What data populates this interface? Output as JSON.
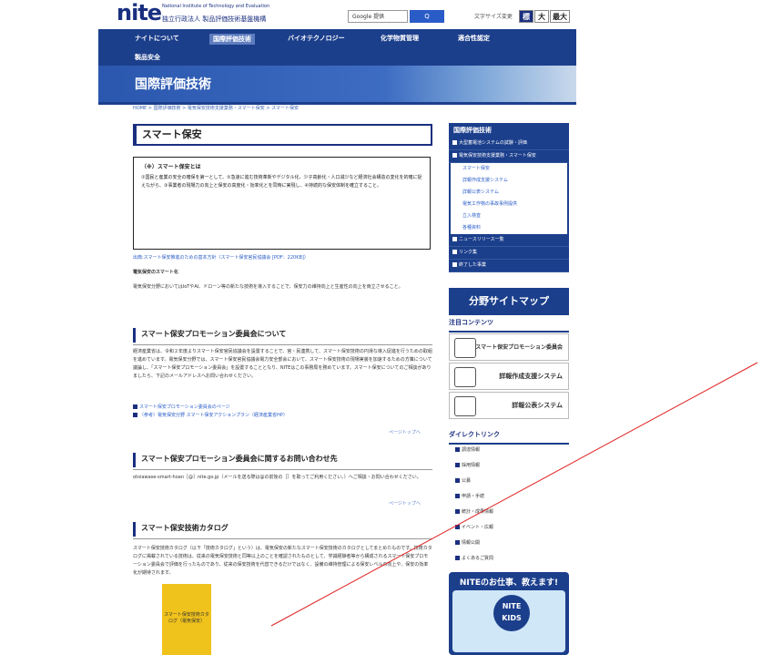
{
  "header": {
    "logo_text": "nite",
    "org_en": "National Institute of Technology and Evaluation",
    "org_jp": "独立行政法人 製品評価技術基盤機構",
    "search_placeholder": "Google 提供",
    "search_button": "Q",
    "font_size_label": "文字サイズ変更",
    "font_sizes": [
      "標準",
      "大",
      "最大"
    ]
  },
  "nav": {
    "items": [
      "ナイトについて",
      "国際評価技術",
      "バイオテクノロジー",
      "化学物質管理",
      "適合性認定",
      "製品安全"
    ]
  },
  "banner": {
    "title": "国際評価技術"
  },
  "breadcrumb": "HOME > 国際評価技術 > 電気保安技術支援業務・スマート保安 > スマート保安",
  "main": {
    "title": "スマート保安",
    "definition_title": "（※）スマート保安とは",
    "definition_text": "①国民と産業の安全の確保を第一として、②急速に進む技術革新やデジタル化、少子高齢化・人口減少など経済社会構造の変化を的確に捉えながら、③事業者の現場力の向上と保安の高度化・効率化とを同時に実現し、④持続的な保安体制を確立すること。",
    "pdf_link": "出典:スマート保安推進のための基本方針（スマート保安官民協議会 [PDF：220KB]）",
    "subtitle": "電気保安のスマート化",
    "subtitle_text": "電気保安分野においてはIoTやAI、ドローン等の新たな技術を導入することで、保安力の維持向上と生産性の向上を両立させること。",
    "section1_title": "スマート保安プロモーション委員会について",
    "section1_text": "経済産業省は、令和２年度よりスマート保安官民協議会を設置することで、官・民連携して、スマート保安技術の円滑な導入促進を行うための取組を進めています。電気保安分野では、スマート保安官民協議会電力安全部会において、スマート保安技術の現場実装を加速するための方策について議論し、「スマート保安プロモーション委員会」を設置することとなり、NITEはこの事務局を務めています。スマート保安についてのご相談がありましたら、下記のメールアドレスへお問い合わせください。",
    "section1_links": [
      "スマート保安プロモーション委員会のページ",
      "（参考）電気保安分野 スマート保安アクションプラン（経済産業省HP）"
    ],
    "page_top": "ページトップへ",
    "section2_title": "スマート保安プロモーション委員会に関するお問い合わせ先",
    "section2_text": "otoiawase-smart-hoan［@］nite.go.jp（メールを送る際は@の前後の［］を取ってご利用ください。）へご相談・お問い合わせください。",
    "section3_title": "スマート保安技術カタログ",
    "section3_text": "スマート保安技術カタログ（以下「技術カタログ」という）は、電気保安の新たなスマート保安技術のカタログとしてまとめたものです。技術カタログに掲載されている技術は、従来の電気保安技術と同等以上のことを確認されたものとして、学識経験者等から構成されるスマート保安プロモーション委員会で評価を行ったものであり、従来の保安技術を代替できるだけではなく、設備の維持管理による保安レベルの向上や、保安の効率化が期待されます。",
    "catalog_label": "スマート保安技術カタログ（電気保安）"
  },
  "sidebar": {
    "heading": "国際評価技術",
    "items": [
      "大型蓄電池システムの試験・評価",
      "電気保安技術支援業務・スマート保安"
    ],
    "subitems": [
      "スマート保安",
      "詳報作成支援システム",
      "詳報公表システム",
      "電気工作物の事故事例提供",
      "立入検査",
      "各種資料"
    ],
    "items2": [
      "ニュースリリース一覧",
      "リンク集",
      "終了した事業"
    ],
    "map_button": "分野サイトマップ",
    "featured_heading": "注目コンテンツ",
    "featured": [
      "スマート保安プロモーション委員会",
      "詳報作成支援システム",
      "詳報公表システム"
    ],
    "direct_heading": "ダイレクトリンク",
    "direct_links": [
      "調達情報",
      "採用情報",
      "公募",
      "申請・手続",
      "統計・成果情報",
      "イベント・広報",
      "情報公開",
      "よくあるご質問"
    ],
    "kids_title": "NITEのお仕事、教えます!",
    "kids_logo": "NITE KIDS"
  }
}
